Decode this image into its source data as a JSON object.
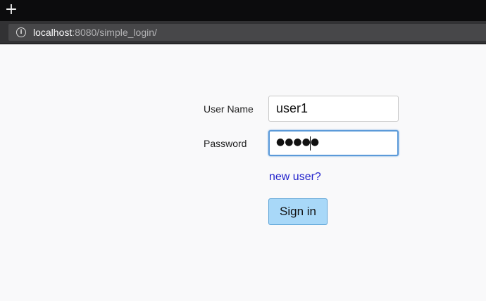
{
  "browser": {
    "new_tab_glyph": "+",
    "address": {
      "host": "localhost",
      "rest": ":8080/simple_login/"
    },
    "info_icon_glyph": "i"
  },
  "form": {
    "username_label": "User Name",
    "username_value": "user1",
    "password_label": "Password",
    "password_value": "●●●●●",
    "new_user_link": "new user?",
    "signin_label": "Sign in"
  },
  "colors": {
    "page_bg": "#f9f9fa",
    "link": "#2222cc",
    "button_bg": "#a8d8f8",
    "focus_ring": "#5b9ad9"
  }
}
